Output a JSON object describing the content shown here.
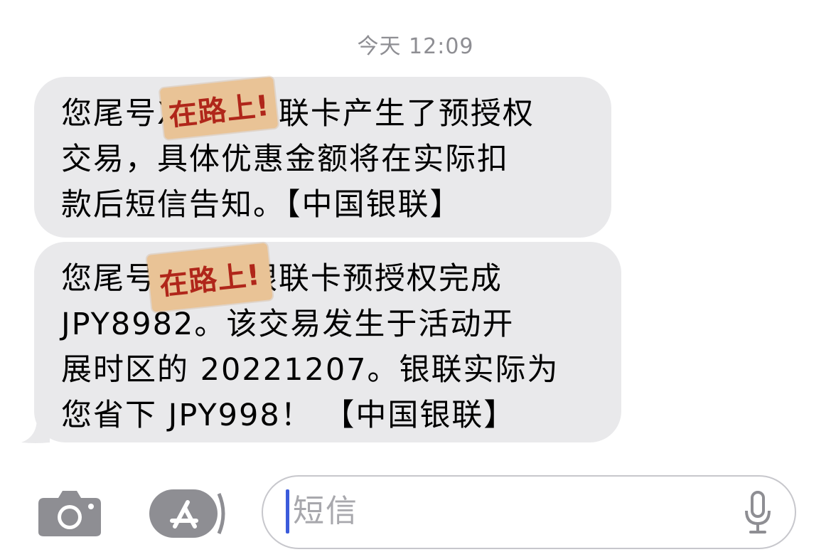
{
  "header": {
    "timestamp": "今天 12:09"
  },
  "messages": [
    {
      "lines": [
        "您尾号XXXX银联卡产生了预授权",
        "交易，具体优惠金额将在实际扣",
        "款后短信告知。【中国银联】"
      ],
      "sticker_text": "在路上!"
    },
    {
      "lines": [
        "您尾号XXXX银联卡预授权完成",
        "JPY8982。该交易发生于活动开",
        "展时区的 20221207。银联实际为",
        "您省下 JPY998！ 【中国银联】"
      ],
      "sticker_text": "在路上!"
    }
  ],
  "composer": {
    "placeholder": "短信",
    "camera_icon": "camera-icon",
    "appstore_icon": "app-store-icon",
    "mic_icon": "microphone-icon"
  },
  "colors": {
    "bubble": "#e9e9eb",
    "timestamp": "#8e8e93",
    "caret": "#3b5bdb",
    "icon": "#8e8e93",
    "sticker_bg": "#e9c396",
    "sticker_text": "#b0261a"
  }
}
